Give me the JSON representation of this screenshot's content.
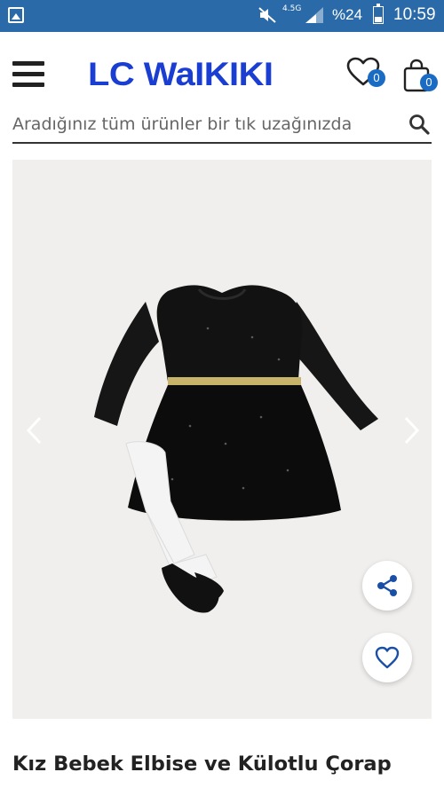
{
  "status_bar": {
    "network": "4.5G",
    "battery": "%24",
    "time": "10:59"
  },
  "header": {
    "logo_text": "LC WaIKIKI",
    "favorites_count": "0",
    "cart_count": "0"
  },
  "search": {
    "placeholder": "Aradığınız tüm ürünler bir tık uzağınızda"
  },
  "product": {
    "title": "Kız Bebek Elbise ve Külotlu Çorap"
  },
  "colors": {
    "status_bar": "#2a6aa8",
    "brand": "#1a3ed2",
    "badge": "#1a6bc4",
    "image_background": "#f0efed"
  },
  "icons": [
    "image-icon",
    "mute-icon",
    "signal-icon",
    "battery-icon",
    "menu-icon",
    "heart-icon",
    "shopping-bag-icon",
    "search-icon",
    "chevron-left-icon",
    "chevron-right-icon",
    "share-icon"
  ]
}
